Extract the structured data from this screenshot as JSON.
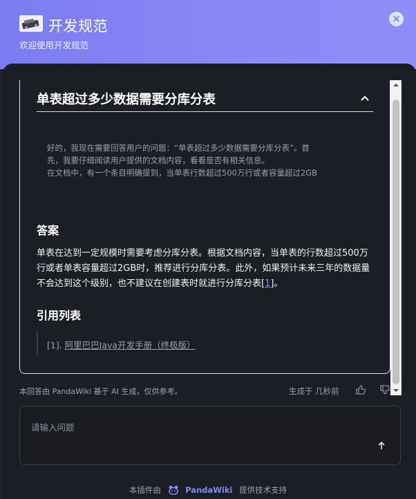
{
  "header": {
    "title": "开发规范",
    "subtitle": "欢迎使用开发规范",
    "close_icon": "close-icon",
    "accent_color": "#7c7cf2"
  },
  "conversation": {
    "question": "单表超过多少数据需要分库分表",
    "thinking": [
      "好的，我现在需要回答用户的问题：“单表超过多少数据需要分库分表”。首",
      "先，我要仔细阅读用户提供的文档内容，看看是否有相关信息。",
      "在文档中，有一个条目明确提到，当单表行数超过500万行或者容量超过2GB"
    ],
    "answer_heading": "答案",
    "answer_text": "单表在达到一定规模时需要考虑分库分表。根据文档内容，当单表的行数超过500万行或者单表容量超过2GB时，推荐进行分库分表。此外，如果预计未来三年的数据量不会达到这个级别，也不建议在创建表时就进行分库分表",
    "answer_citation": "1",
    "answer_end": "。",
    "references_heading": "引用列表",
    "references": [
      {
        "index": "[1].",
        "title": "阿里巴巴Java开发手册（终极版）"
      }
    ]
  },
  "meta": {
    "disclaimer": "本回答由 PandaWiki 基于 AI 生成，仅供参考。",
    "generated": "生成于 几秒前"
  },
  "input": {
    "placeholder": "请输入问题",
    "value": ""
  },
  "footer": {
    "prefix": "本插件由",
    "brand": "PandaWiki",
    "suffix": "提供技术支持"
  }
}
